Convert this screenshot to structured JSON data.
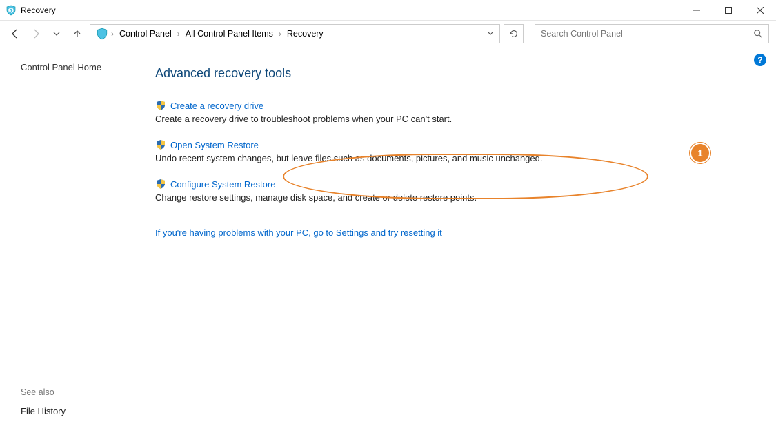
{
  "window": {
    "title": "Recovery"
  },
  "breadcrumb": {
    "items": [
      "Control Panel",
      "All Control Panel Items",
      "Recovery"
    ]
  },
  "search": {
    "placeholder": "Search Control Panel"
  },
  "sidebar": {
    "home": "Control Panel Home",
    "see_also_label": "See also",
    "file_history": "File History"
  },
  "main": {
    "heading": "Advanced recovery tools",
    "tools": [
      {
        "link": "Create a recovery drive",
        "desc": "Create a recovery drive to troubleshoot problems when your PC can't start."
      },
      {
        "link": "Open System Restore",
        "desc": "Undo recent system changes, but leave files such as documents, pictures, and music unchanged."
      },
      {
        "link": "Configure System Restore",
        "desc": "Change restore settings, manage disk space, and create or delete restore points."
      }
    ],
    "problems_link": "If you're having problems with your PC, go to Settings and try resetting it"
  },
  "annotation": {
    "badge": "1"
  }
}
